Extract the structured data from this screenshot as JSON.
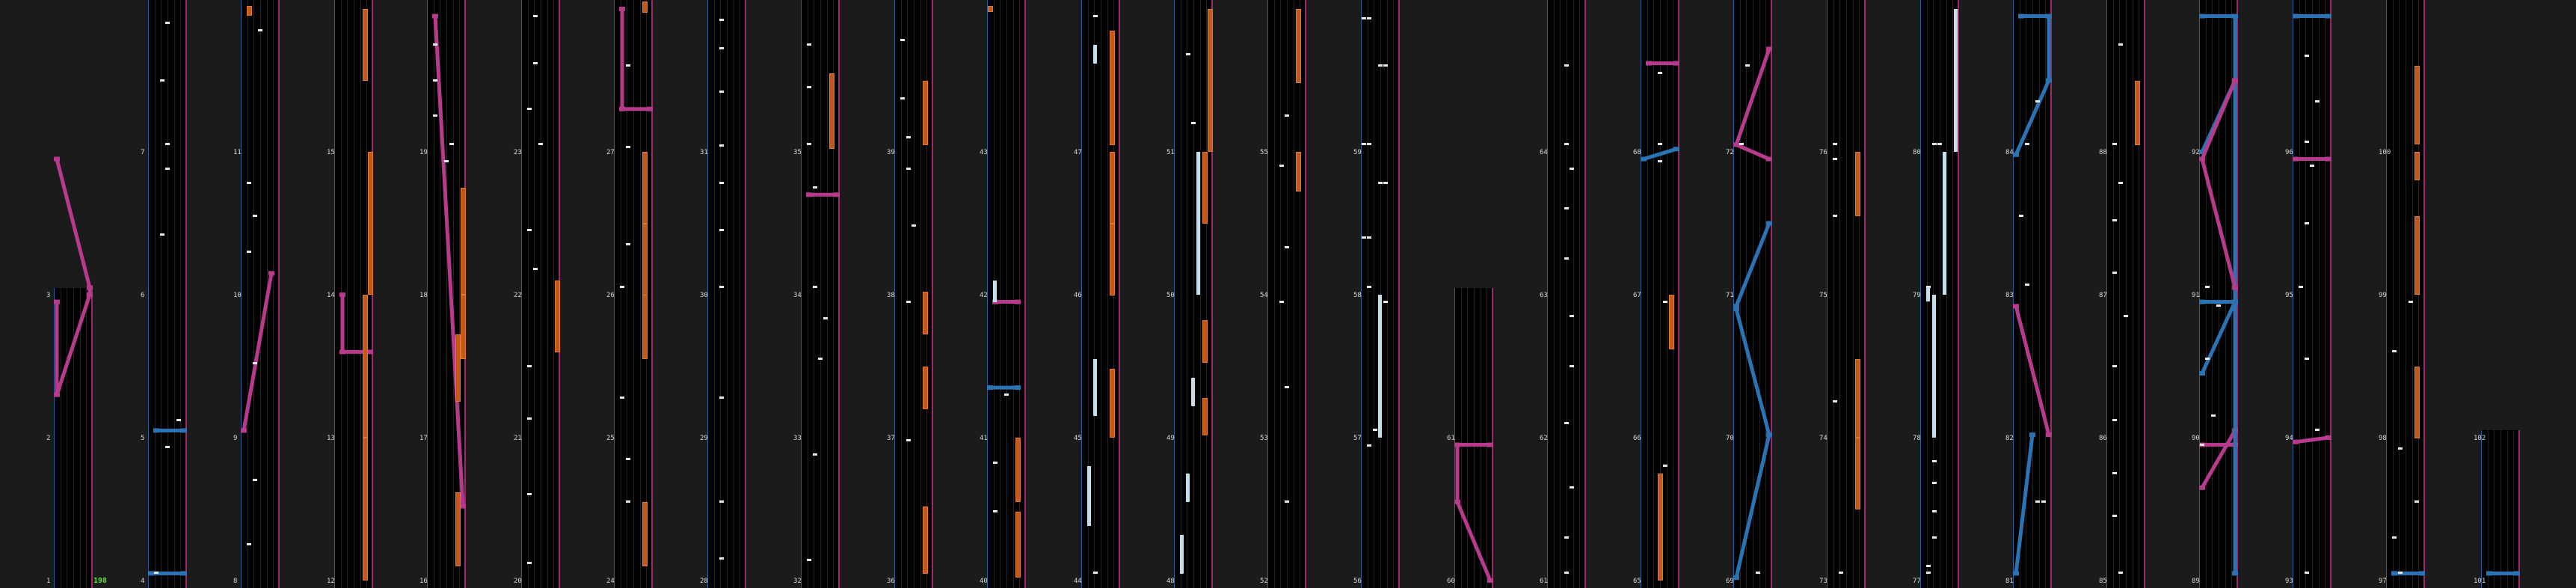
{
  "colors": {
    "background": "#1b1b1b",
    "lane": "#000000",
    "lane_left_edge": "#2a5e9c",
    "lane_right_edge": "#9a2a6b",
    "note": "#e8e8e8",
    "hold": "#c2591b",
    "slide_pink": "#b83a8c",
    "slide_blue": "#2a73b5",
    "scratch": "#c7ddea",
    "combo": "#5ee23a"
  },
  "chart_view": {
    "combo_label": "198",
    "measures": [
      "1",
      "2",
      "3",
      "4",
      "5",
      "6",
      "7",
      "8",
      "9",
      "10",
      "11",
      "12",
      "13",
      "14",
      "15",
      "16",
      "17",
      "18",
      "19",
      "20",
      "21",
      "22",
      "23",
      "24",
      "25",
      "26",
      "27",
      "28",
      "29",
      "30",
      "31",
      "32",
      "33",
      "34",
      "35",
      "36",
      "37",
      "38",
      "39",
      "40",
      "41",
      "42",
      "43",
      "44",
      "45",
      "46",
      "47",
      "48",
      "49",
      "50",
      "51",
      "52",
      "53",
      "54",
      "55",
      "56",
      "57",
      "58",
      "59",
      "60",
      "61",
      "62",
      "63",
      "64",
      "65",
      "66",
      "67",
      "68",
      "69",
      "70",
      "71",
      "72",
      "73",
      "74",
      "75",
      "76",
      "77",
      "78",
      "79",
      "80",
      "81",
      "82",
      "83",
      "84",
      "85",
      "86",
      "87",
      "88",
      "89",
      "90",
      "91",
      "92",
      "93",
      "94",
      "95",
      "96",
      "97",
      "98",
      "99",
      "100",
      "101",
      "102"
    ]
  }
}
